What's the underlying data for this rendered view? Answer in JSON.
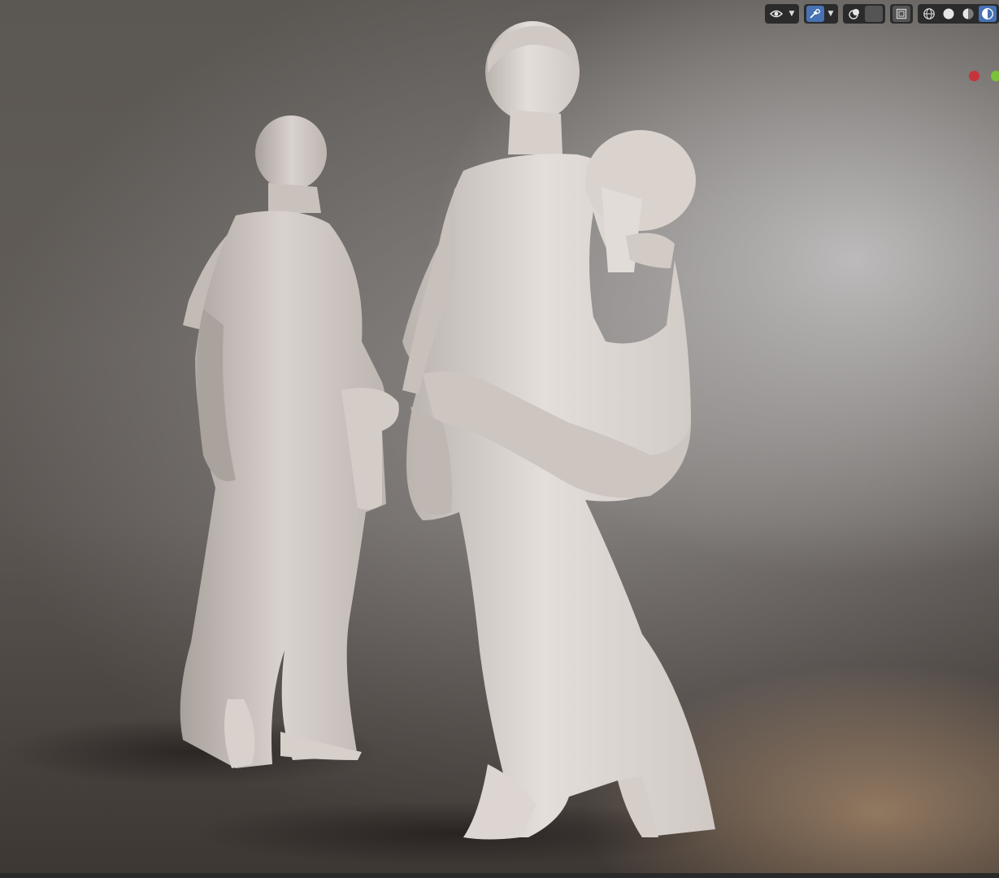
{
  "window": {
    "background_accent": "#d6b08a"
  },
  "header": {
    "icons": [
      {
        "name": "selectability-visibility-icon",
        "group": 0
      },
      {
        "name": "gizmo-toggle-icon",
        "group": 1
      },
      {
        "name": "overlays-toggle-icon",
        "group": 2
      },
      {
        "name": "xray-toggle-icon",
        "group": 3
      },
      {
        "name": "wireframe-shading-icon",
        "group": 4
      },
      {
        "name": "solid-shading-icon",
        "group": 4
      },
      {
        "name": "material-preview-shading-icon",
        "group": 4
      },
      {
        "name": "rendered-shading-icon",
        "group": 4
      }
    ],
    "active_color": "#4772b3"
  },
  "gizmo": {
    "x_axis_color": "#c8323c",
    "y_axis_color": "#7ac23a"
  }
}
